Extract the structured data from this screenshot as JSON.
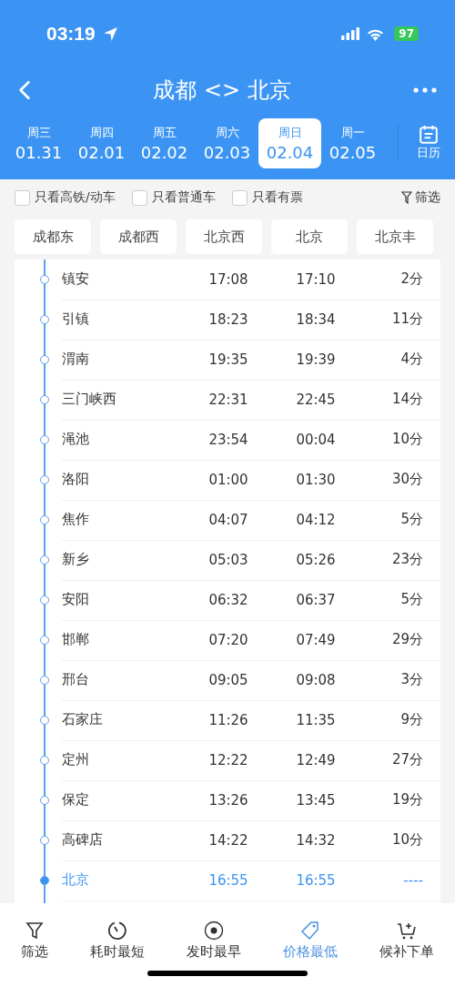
{
  "status_bar": {
    "time": "03:19",
    "battery": "97"
  },
  "nav": {
    "title": "成都 <> 北京"
  },
  "dates": [
    {
      "weekday": "周三",
      "date": "01.31",
      "selected": false
    },
    {
      "weekday": "周四",
      "date": "02.01",
      "selected": false
    },
    {
      "weekday": "周五",
      "date": "02.02",
      "selected": false
    },
    {
      "weekday": "周六",
      "date": "02.03",
      "selected": false
    },
    {
      "weekday": "周日",
      "date": "02.04",
      "selected": true
    },
    {
      "weekday": "周一",
      "date": "02.05",
      "selected": false
    }
  ],
  "calendar_button": {
    "label": "日历"
  },
  "filters": [
    {
      "label": "只看高铁/动车",
      "checked": false
    },
    {
      "label": "只看普通车",
      "checked": false
    },
    {
      "label": "只看有票",
      "checked": false
    }
  ],
  "filter_link": {
    "label": "筛选"
  },
  "station_chips": [
    "成都东",
    "成都西",
    "北京西",
    "北京",
    "北京丰"
  ],
  "stops": [
    {
      "name": "镇安",
      "arrive": "17:08",
      "depart": "17:10",
      "stay": "2分",
      "kind": "stop"
    },
    {
      "name": "引镇",
      "arrive": "18:23",
      "depart": "18:34",
      "stay": "11分",
      "kind": "stop"
    },
    {
      "name": "渭南",
      "arrive": "19:35",
      "depart": "19:39",
      "stay": "4分",
      "kind": "stop"
    },
    {
      "name": "三门峡西",
      "arrive": "22:31",
      "depart": "22:45",
      "stay": "14分",
      "kind": "stop"
    },
    {
      "name": "渑池",
      "arrive": "23:54",
      "depart": "00:04",
      "stay": "10分",
      "kind": "stop"
    },
    {
      "name": "洛阳",
      "arrive": "01:00",
      "depart": "01:30",
      "stay": "30分",
      "kind": "stop"
    },
    {
      "name": "焦作",
      "arrive": "04:07",
      "depart": "04:12",
      "stay": "5分",
      "kind": "stop"
    },
    {
      "name": "新乡",
      "arrive": "05:03",
      "depart": "05:26",
      "stay": "23分",
      "kind": "stop"
    },
    {
      "name": "安阳",
      "arrive": "06:32",
      "depart": "06:37",
      "stay": "5分",
      "kind": "stop"
    },
    {
      "name": "邯郸",
      "arrive": "07:20",
      "depart": "07:49",
      "stay": "29分",
      "kind": "stop"
    },
    {
      "name": "邢台",
      "arrive": "09:05",
      "depart": "09:08",
      "stay": "3分",
      "kind": "stop"
    },
    {
      "name": "石家庄",
      "arrive": "11:26",
      "depart": "11:35",
      "stay": "9分",
      "kind": "stop"
    },
    {
      "name": "定州",
      "arrive": "12:22",
      "depart": "12:49",
      "stay": "27分",
      "kind": "stop"
    },
    {
      "name": "保定",
      "arrive": "13:26",
      "depart": "13:45",
      "stay": "19分",
      "kind": "stop"
    },
    {
      "name": "高碑店",
      "arrive": "14:22",
      "depart": "14:32",
      "stay": "10分",
      "kind": "stop"
    },
    {
      "name": "北京",
      "arrive": "16:55",
      "depart": "16:55",
      "stay": "----",
      "kind": "terminal"
    }
  ],
  "bottom_tabs": [
    {
      "label": "筛选",
      "kind": "filter",
      "selected": false
    },
    {
      "label": "耗时最短",
      "kind": "timer",
      "selected": false
    },
    {
      "label": "发时最早",
      "kind": "clock24",
      "selected": false
    },
    {
      "label": "价格最低",
      "kind": "tag",
      "selected": true
    },
    {
      "label": "候补下单",
      "kind": "cart",
      "selected": false
    }
  ]
}
